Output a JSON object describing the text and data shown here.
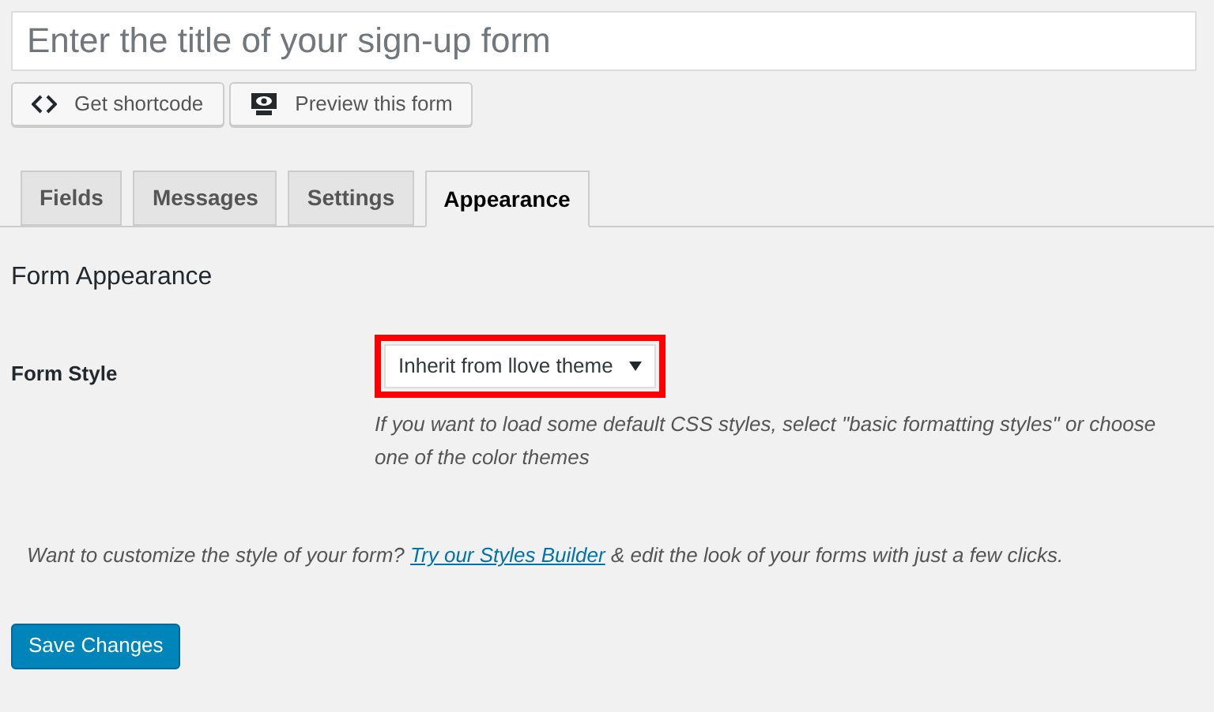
{
  "title_field": {
    "placeholder": "Enter the title of your sign-up form"
  },
  "actions": [
    {
      "kind": "code",
      "label": "Get shortcode"
    },
    {
      "kind": "preview",
      "label": "Preview this form"
    }
  ],
  "tabs": [
    {
      "label": "Fields",
      "selected": false
    },
    {
      "label": "Messages",
      "selected": false
    },
    {
      "label": "Settings",
      "selected": false
    },
    {
      "label": "Appearance",
      "selected": true
    }
  ],
  "section_title": "Form Appearance",
  "form_style": {
    "label": "Form Style",
    "value": "Inherit from llove theme",
    "highlighted": true,
    "help": "If you want to load some default CSS styles, select \"basic formatting styles\" or choose one of the color themes"
  },
  "tip": {
    "before": "Want to customize the style of your form?",
    "link": "Try our Styles Builder",
    "after": "& edit the look of your forms with just a few clicks."
  },
  "save_button": "Save Changes"
}
